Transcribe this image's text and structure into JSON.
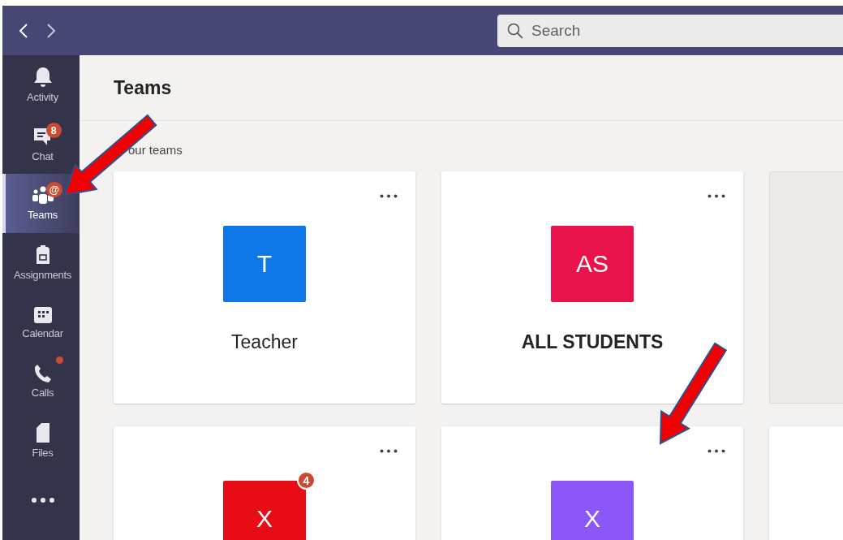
{
  "titlebar": {
    "search": {
      "placeholder": "Search"
    }
  },
  "rail": {
    "items": [
      {
        "kind": "activity",
        "label": "Activity",
        "selected": false
      },
      {
        "kind": "chat",
        "label": "Chat",
        "selected": false,
        "badge": "8"
      },
      {
        "kind": "teams",
        "label": "Teams",
        "selected": true,
        "badge": "@"
      },
      {
        "kind": "assignments",
        "label": "Assignments",
        "selected": false
      },
      {
        "kind": "calendar",
        "label": "Calendar",
        "selected": false
      },
      {
        "kind": "calls",
        "label": "Calls",
        "selected": false,
        "dot": true
      },
      {
        "kind": "files",
        "label": "Files",
        "selected": false
      },
      {
        "kind": "more",
        "selected": false
      }
    ]
  },
  "page": {
    "title": "Teams",
    "section": "our teams"
  },
  "cards": [
    {
      "kind": "team",
      "initials": "T",
      "color": "#0f78e8",
      "name": "Teacher",
      "bold": false
    },
    {
      "kind": "team",
      "initials": "AS",
      "color": "#e8134a",
      "name": "ALL STUDENTS",
      "bold": true
    },
    {
      "kind": "partial",
      "shaded": true
    },
    {
      "kind": "team",
      "initials": "X",
      "color": "#e80c16",
      "badge": "4"
    },
    {
      "kind": "team",
      "initials": "X",
      "color": "#8b57f6"
    },
    {
      "kind": "partial",
      "shaded": false
    }
  ],
  "annotations": [
    {
      "kind": "arrow"
    },
    {
      "kind": "arrow"
    }
  ]
}
